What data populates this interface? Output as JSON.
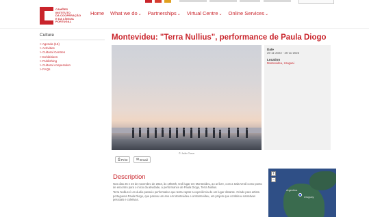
{
  "logo": {
    "lines": [
      "CAMÕES",
      "INSTITUTO",
      "DA COOPERAÇÃO",
      "E DA LÍNGUA",
      "PORTUGAL"
    ]
  },
  "nav": {
    "items": [
      {
        "label": "Home",
        "has_menu": false
      },
      {
        "label": "What we do",
        "has_menu": true
      },
      {
        "label": "Partnerships",
        "has_menu": true
      },
      {
        "label": "Virtual Centre",
        "has_menu": true
      },
      {
        "label": "Online Services",
        "has_menu": true
      }
    ]
  },
  "sidebar": {
    "title": "Culture",
    "items": [
      "> Agenda (15)",
      "> Activities",
      "> Cultural Centres",
      "> Exhibitions",
      "> Publishing",
      "> Cultural cooperation",
      "> FAQs"
    ]
  },
  "page": {
    "title": "Montevideu: \"Terra Nullius\", performance de Paula Diogo",
    "photo_credit": "© João Tuna"
  },
  "info": {
    "date_label": "Date",
    "date_value": "25-11-2023 - 26-11-2023",
    "location_label": "Location",
    "location_value": "Montevideu, Uruguai"
  },
  "actions": {
    "print_label": "Print",
    "email_label": "Email"
  },
  "description": {
    "title": "Description",
    "paragraphs": [
      "Nos dias 25 e 26 de novembro de 2023, às 19h30h, terá lugar em Montevideu, ao ar livre, com a Sala Verdi como ponto de encontro para o início da atividade, a performance de Paula Diogo, Terra Nullius.",
      "Terra Nullius é um áudio-passeio performativo que tenta captar a experiência de um lugar distante. Criado para artista portuguesa Paula Diogo, que passou um ano em Montevideu e a Montevideu, um projeto que combinou narrativas pessoais e coletivas."
    ]
  },
  "map": {
    "zoom_in": "+",
    "zoom_out": "−",
    "labels": [
      "Argentina",
      "Uruguay"
    ]
  },
  "colors": {
    "brand": "#c9242b",
    "info_bg": "#f1f1f1"
  }
}
